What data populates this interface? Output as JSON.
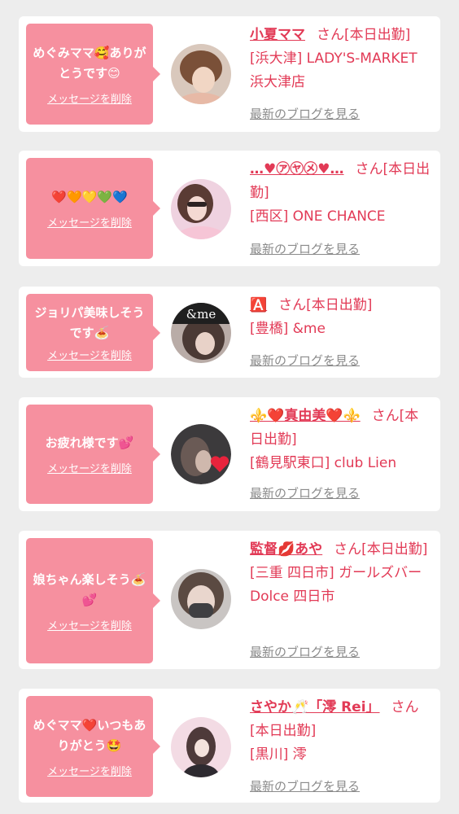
{
  "cards": [
    {
      "message": "めぐみママ🥰ありがとうです😊",
      "delete_label": "メッセージを削除",
      "name": "小夏ママ",
      "suffix": "さん[本日出勤]",
      "shop": "[浜大津] LADY'S-MARKET 浜大津店",
      "blog_label": "最新のブログを見る"
    },
    {
      "message": "❤️🧡💛💚💙",
      "delete_label": "メッセージを削除",
      "name": "…♥㋐㋳㋱♥…",
      "suffix": "さん[本日出勤]",
      "shop": "[西区] ONE CHANCE",
      "blog_label": "最新のブログを見る"
    },
    {
      "message": "ジョリパ美味しそうです🍝",
      "delete_label": "メッセージを削除",
      "name": "🅰️",
      "suffix": "さん[本日出勤]",
      "shop": "[豊橋] &me",
      "blog_label": "最新のブログを見る",
      "avatar_text": "&me"
    },
    {
      "message": "お疲れ様です💕",
      "delete_label": "メッセージを削除",
      "name": "⚜️❤️真由美❤️⚜️",
      "suffix": "さん[本日出勤]",
      "shop": "[鶴見駅東口] club Lien",
      "blog_label": "最新のブログを見る"
    },
    {
      "message": "娘ちゃん楽しそう🍝💕",
      "delete_label": "メッセージを削除",
      "name": "監督💋あや",
      "suffix": "さん[本日出勤]",
      "shop": "[三重 四日市] ガールズバー Dolce 四日市",
      "blog_label": "最新のブログを見る"
    },
    {
      "message": "めぐママ❤️いつもありがとう🤩",
      "delete_label": "メッセージを削除",
      "name": "さやか🥂「澪 Rei」",
      "suffix": "さん[本日出勤]",
      "shop": "[黒川] 澪",
      "blog_label": "最新のブログを見る"
    }
  ],
  "colors": {
    "page_bg": "#ededed",
    "bubble": "#f6909f",
    "accent_text": "#e23a56",
    "link_gray": "#8b8b8b"
  }
}
